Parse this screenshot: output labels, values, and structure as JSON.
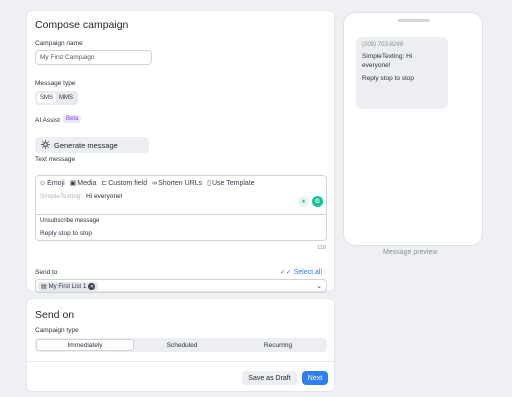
{
  "compose": {
    "title": "Compose campaign",
    "campaign_name_label": "Campaign name",
    "campaign_name_value": "My First Campaign",
    "message_type_label": "Message type",
    "message_types": [
      "SMS",
      "MMS"
    ],
    "ai_assist_label": "AI Assist",
    "beta_label": "Beta",
    "generate_label": "Generate message",
    "text_message_label": "Text message",
    "toolbar": {
      "emoji": "Emoji",
      "media": "Media",
      "custom_field": "Custom field",
      "shorten_urls": "Shorten URLs",
      "use_template": "Use Template"
    },
    "prefix": "SimpleTexting:",
    "message": "Hi everyone!",
    "unsubscribe_label": "Unsubscribe message",
    "unsubscribe_value": "Reply stop to stop",
    "char_count": "118",
    "send_to_label": "Send to",
    "select_all": "Select all",
    "list_chip": "My First List",
    "list_count": "1"
  },
  "send_on": {
    "title": "Send on",
    "campaign_type_label": "Campaign type",
    "types": [
      "Immediately",
      "Scheduled",
      "Recurring"
    ],
    "save_draft": "Save as Draft",
    "next": "Next"
  },
  "preview": {
    "number": "(209) 703-8268",
    "line1": "SimpleTexting: Hi",
    "line2": "everyone!",
    "line3": "Reply stop to stop",
    "label": "Message preview"
  },
  "colors": {
    "accent": "#2f80ed",
    "beta": "#7a4bd6",
    "grammarly": "#15c39a"
  }
}
